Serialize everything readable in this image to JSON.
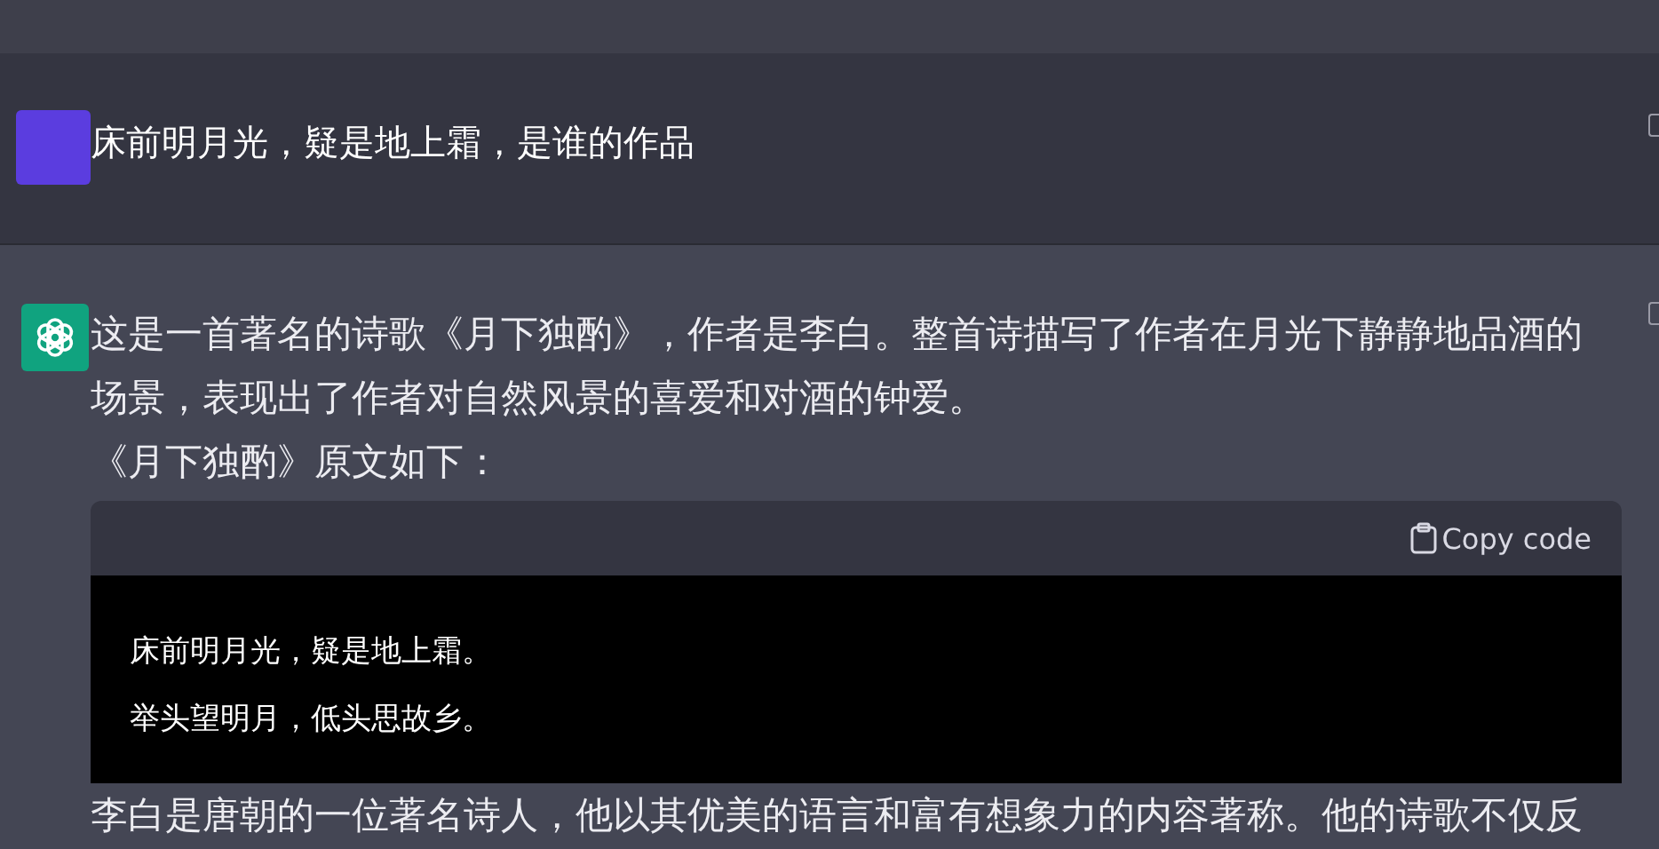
{
  "user_message": {
    "text": "床前明月光，疑是地上霜，是谁的作品"
  },
  "assistant_message": {
    "paragraphs": [
      "这是一首著名的诗歌《月下独酌》，作者是李白。整首诗描写了作者在月光下静静地品酒的场景，表现出了作者对自然风景的喜爱和对酒的钟爱。",
      "《月下独酌》原文如下："
    ],
    "code": {
      "copy_label": "Copy code",
      "lines": [
        "床前明月光，疑是地上霜。",
        "举头望明月，低头思故乡。"
      ]
    },
    "after_text": "李白是唐朝的一位著名诗人，他以其优美的语言和富有想象力的内容著称。他的诗歌不仅反"
  }
}
